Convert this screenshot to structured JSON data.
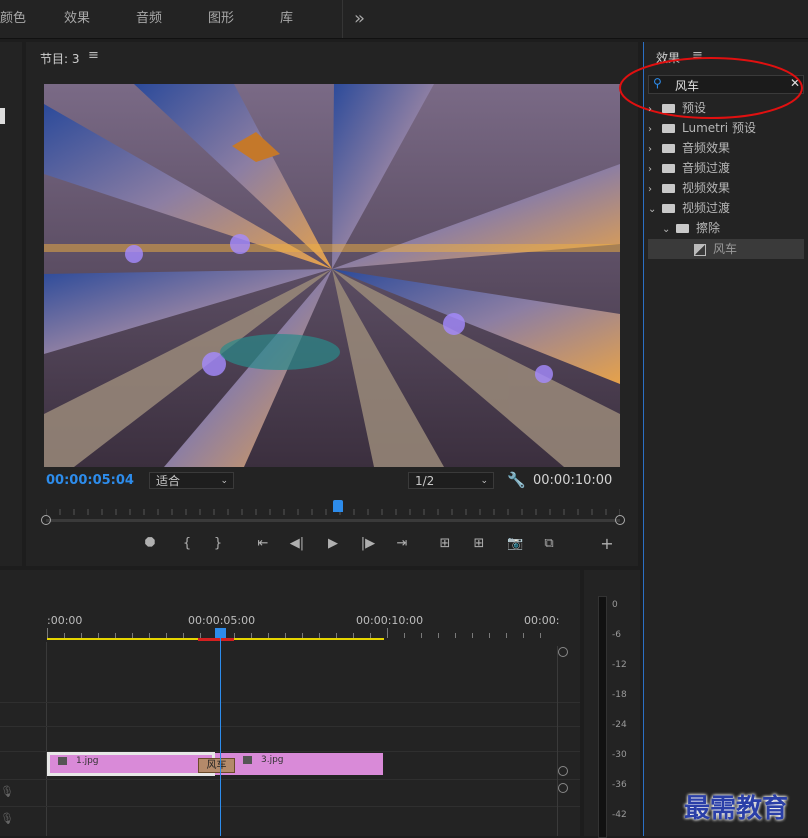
{
  "top_tabs": [
    "颜色",
    "效果",
    "音频",
    "图形",
    "库"
  ],
  "top_more": "»",
  "program": {
    "title": "节目: 3",
    "timecode_current": "00:00:05:04",
    "fit_label": "适合",
    "resolution_label": "1/2",
    "timecode_duration": "00:00:10:00"
  },
  "effects_panel": {
    "title": "效果",
    "search_value": "风车",
    "tree": [
      {
        "label": "预设",
        "expanded": false
      },
      {
        "label": "Lumetri 预设",
        "expanded": false
      },
      {
        "label": "音频效果",
        "expanded": false
      },
      {
        "label": "音频过渡",
        "expanded": false
      },
      {
        "label": "视频效果",
        "expanded": false
      },
      {
        "label": "视频过渡",
        "expanded": true
      },
      {
        "label": "擦除",
        "expanded": true
      },
      {
        "label": "风车",
        "selected": true
      }
    ]
  },
  "timeline": {
    "ruler_labels": [
      ":00:00",
      "00:00:05:00",
      "00:00:10:00",
      "00:00:"
    ],
    "clips": [
      {
        "name": "1.jpg"
      },
      {
        "name": "3.jpg"
      }
    ],
    "transition_label": "风车"
  },
  "meter_labels": [
    "0",
    "-6",
    "-12",
    "-18",
    "-24",
    "-30",
    "-36",
    "-42"
  ],
  "watermark": "最需教育",
  "colors": {
    "accent_blue": "#2d8ceb",
    "clip_pink": "#d98ad8",
    "annotation_red": "#e01010",
    "workarea_yellow": "#e5d400"
  }
}
